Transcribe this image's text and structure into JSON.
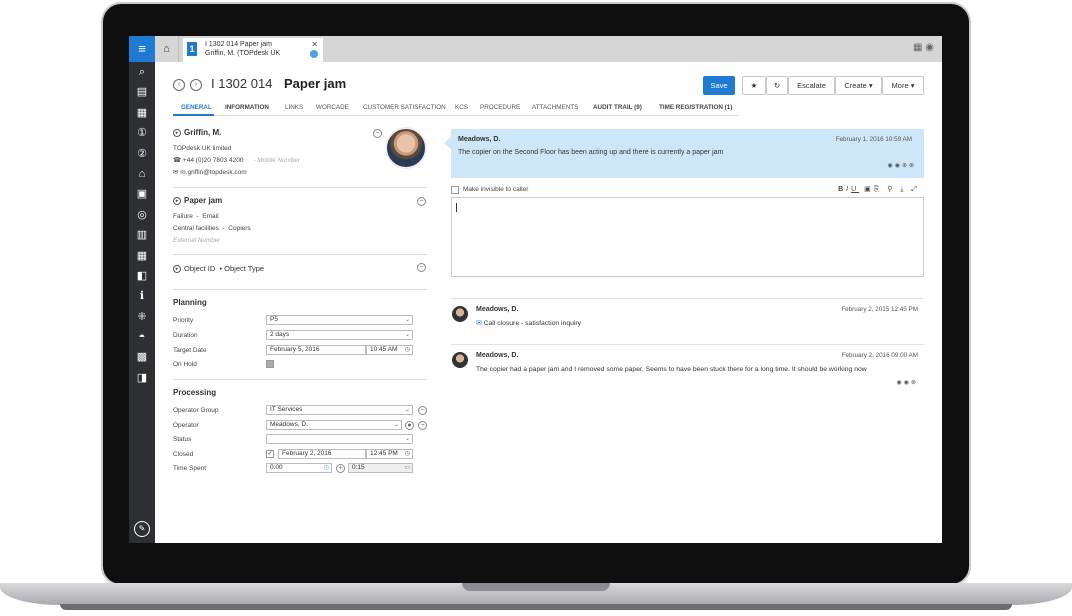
{
  "app": {
    "tab": {
      "number": "1",
      "line1": "I 1302 014 Paper jam",
      "line2": "Griffin, M. (TOPdesk UK"
    }
  },
  "header": {
    "id": "I 1302 014",
    "title": "Paper jam",
    "buttons": {
      "save": "Save",
      "escalate": "Escalate",
      "create": "Create ▾",
      "more": "More ▾"
    }
  },
  "tabs": [
    "GENERAL",
    "INFORMATION",
    "LINKS",
    "WORCADE",
    "CUSTOMER SATISFACTION",
    "KCS",
    "PROCEDURE",
    "ATTACHMENTS",
    "AUDIT TRAIL (9)",
    "TIME REGISTRATION (1)"
  ],
  "caller": {
    "name": "Griffin, M.",
    "company": "TOPdesk UK limited",
    "phone": "+44 (0)20 7803 4200",
    "mobile_placeholder": "- Mobile Number",
    "email": "m.griffin@topdesk.com"
  },
  "request": {
    "title": "Paper jam",
    "category1": "Failure",
    "sub1": "Email",
    "category2": "Central facilities",
    "sub2": "Copiers",
    "external": "External Number"
  },
  "object": {
    "id_label": "Object ID",
    "type_label": "Object Type"
  },
  "planning": {
    "heading": "Planning",
    "priority_label": "Priority",
    "priority": "P5",
    "duration_label": "Duration",
    "duration": "2 days",
    "target_label": "Target Date",
    "target_date": "February 5, 2016",
    "target_time": "10:45 AM",
    "onhold_label": "On Hold"
  },
  "processing": {
    "heading": "Processing",
    "group_label": "Operator Group",
    "group": "IT Services",
    "operator_label": "Operator",
    "operator": "Meadows, D.",
    "status_label": "Status",
    "status": "",
    "closed_label": "Closed",
    "closed_date": "February 2, 2016",
    "closed_time": "12:45 PM",
    "timespent_label": "Time Spent",
    "time_spent": "0:00",
    "time_add": "0:15"
  },
  "request_bubble": {
    "author": "Meadows, D.",
    "date": "February 1, 2016 10:59 AM",
    "text": "The copier on the Second Floor has been acting up and there is currently a paper jam"
  },
  "editor": {
    "invisible_label": "Make invisible to caller"
  },
  "entries": [
    {
      "author": "Meadows, D.",
      "date": "February 2, 2015 12:45 PM",
      "text": "Call closure - satisfaction inquiry"
    },
    {
      "author": "Meadows, D.",
      "date": "February 2, 2016 09:00 AM",
      "text": "The copier had a paper jam and I removed some paper. Seems to have been stuck there for a long time. It should be working now"
    }
  ],
  "colors": {
    "accent": "#1f7ad1",
    "bubble": "#cde7f8",
    "rail": "#2d2f33"
  }
}
